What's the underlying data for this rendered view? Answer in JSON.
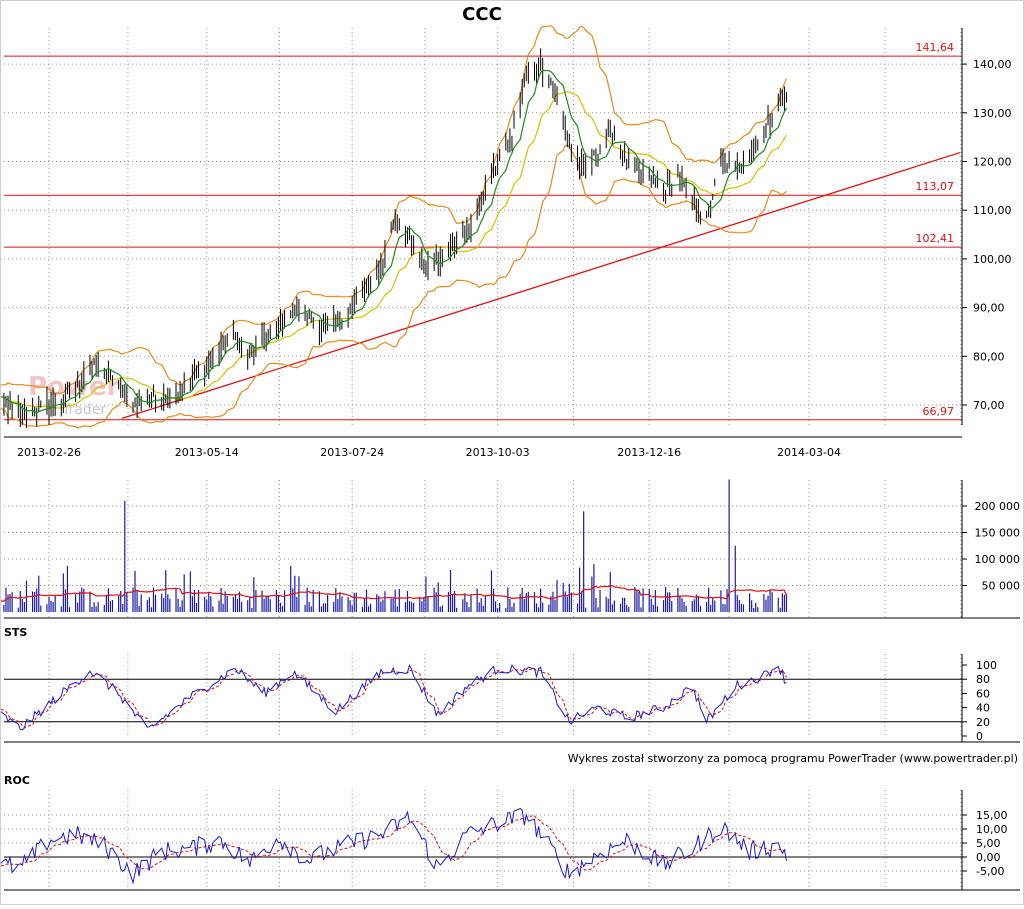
{
  "chart_data": [
    {
      "type": "line",
      "title": "CCC",
      "panel": "price",
      "subtype": "ohlc-bars with moving averages and bollinger bands",
      "x_labels": [
        "2013-02-26",
        "2013-05-14",
        "2013-07-24",
        "2013-10-03",
        "2013-12-16",
        "2014-03-04"
      ],
      "y_ticks": [
        70,
        80,
        90,
        100,
        110,
        120,
        130,
        140
      ],
      "y_tick_labels": [
        "70,00",
        "80,00",
        "90,00",
        "100,00",
        "110,00",
        "120,00",
        "130,00",
        "140,00"
      ],
      "ylim": [
        65,
        145
      ],
      "ylabel": "",
      "xlabel": "",
      "grid": true,
      "levels": [
        {
          "label": "141,64",
          "value": 141.64
        },
        {
          "label": "113,07",
          "value": 113.07
        },
        {
          "label": "102,41",
          "value": 102.41
        },
        {
          "label": "66,97",
          "value": 66.97
        }
      ],
      "trendline": {
        "from": {
          "x": "2013-02-26",
          "y": 62.5
        },
        "to": {
          "x": "2014-03-04",
          "y": 112.0
        }
      },
      "close_anchor_points": [
        [
          "2013-01-29",
          72
        ],
        [
          "2013-02-04",
          70
        ],
        [
          "2013-02-12",
          68
        ],
        [
          "2013-02-26",
          70
        ],
        [
          "2013-03-05",
          71
        ],
        [
          "2013-03-11",
          74
        ],
        [
          "2013-03-18",
          78
        ],
        [
          "2013-03-25",
          77
        ],
        [
          "2013-04-01",
          74
        ],
        [
          "2013-04-08",
          70
        ],
        [
          "2013-04-15",
          71
        ],
        [
          "2013-04-22",
          72
        ],
        [
          "2013-04-29",
          72
        ],
        [
          "2013-05-06",
          75
        ],
        [
          "2013-05-14",
          78
        ],
        [
          "2013-05-21",
          82
        ],
        [
          "2013-05-28",
          84
        ],
        [
          "2013-06-04",
          80
        ],
        [
          "2013-06-11",
          84
        ],
        [
          "2013-06-18",
          86
        ],
        [
          "2013-06-25",
          90
        ],
        [
          "2013-07-02",
          89
        ],
        [
          "2013-07-09",
          85
        ],
        [
          "2013-07-16",
          87
        ],
        [
          "2013-07-24",
          90
        ],
        [
          "2013-07-31",
          94
        ],
        [
          "2013-08-07",
          98
        ],
        [
          "2013-08-14",
          109
        ],
        [
          "2013-08-21",
          104
        ],
        [
          "2013-08-28",
          98
        ],
        [
          "2013-09-04",
          100
        ],
        [
          "2013-09-11",
          104
        ],
        [
          "2013-09-18",
          105
        ],
        [
          "2013-09-25",
          112
        ],
        [
          "2013-10-03",
          120
        ],
        [
          "2013-10-10",
          125
        ],
        [
          "2013-10-17",
          138
        ],
        [
          "2013-10-24",
          140
        ],
        [
          "2013-10-31",
          135
        ],
        [
          "2013-11-07",
          124
        ],
        [
          "2013-11-14",
          118
        ],
        [
          "2013-11-21",
          122
        ],
        [
          "2013-11-28",
          126
        ],
        [
          "2013-12-05",
          120
        ],
        [
          "2013-12-16",
          116
        ],
        [
          "2013-12-23",
          114
        ],
        [
          "2013-12-30",
          117
        ],
        [
          "2014-01-06",
          112
        ],
        [
          "2014-01-13",
          108
        ],
        [
          "2014-01-20",
          120
        ],
        [
          "2014-01-27",
          118
        ],
        [
          "2014-02-03",
          122
        ],
        [
          "2014-02-10",
          126
        ],
        [
          "2014-02-17",
          132
        ],
        [
          "2014-02-21",
          133
        ]
      ]
    },
    {
      "type": "bar",
      "panel": "volume",
      "y_ticks": [
        50000,
        100000,
        150000,
        200000
      ],
      "y_tick_labels": [
        "50 000",
        "100 000",
        "150 000",
        "200 000"
      ],
      "ylim": [
        0,
        250000
      ],
      "spikes": [
        {
          "x": "2013-04-04",
          "value": 210000
        },
        {
          "x": "2013-11-14",
          "value": 190000
        },
        {
          "x": "2014-01-24",
          "value": 250000
        },
        {
          "x": "2014-01-27",
          "value": 125000
        }
      ],
      "baseline_level": 25000
    },
    {
      "type": "line",
      "title": "STS",
      "panel": "stochastic",
      "y_ticks": [
        0,
        20,
        40,
        60,
        80,
        100
      ],
      "y_tick_labels": [
        "0",
        "20",
        "40",
        "60",
        "80",
        "100"
      ],
      "ylim": [
        0,
        100
      ],
      "levels": [
        20,
        80
      ],
      "anchor_points": [
        [
          "2013-01-29",
          40
        ],
        [
          "2013-02-12",
          10
        ],
        [
          "2013-02-26",
          45
        ],
        [
          "2013-03-18",
          92
        ],
        [
          "2013-04-01",
          60
        ],
        [
          "2013-04-15",
          8
        ],
        [
          "2013-05-06",
          55
        ],
        [
          "2013-05-28",
          95
        ],
        [
          "2013-06-11",
          60
        ],
        [
          "2013-06-25",
          90
        ],
        [
          "2013-07-16",
          35
        ],
        [
          "2013-08-07",
          90
        ],
        [
          "2013-08-21",
          95
        ],
        [
          "2013-09-04",
          30
        ],
        [
          "2013-09-18",
          70
        ],
        [
          "2013-10-03",
          95
        ],
        [
          "2013-10-24",
          90
        ],
        [
          "2013-11-07",
          20
        ],
        [
          "2013-11-21",
          40
        ],
        [
          "2013-12-05",
          25
        ],
        [
          "2013-12-23",
          40
        ],
        [
          "2014-01-06",
          70
        ],
        [
          "2014-01-13",
          20
        ],
        [
          "2014-01-27",
          70
        ],
        [
          "2014-02-10",
          85
        ],
        [
          "2014-02-17",
          100
        ],
        [
          "2014-02-21",
          75
        ]
      ]
    },
    {
      "type": "line",
      "title": "ROC",
      "panel": "rate-of-change",
      "y_ticks": [
        -5,
        0,
        5,
        10,
        15
      ],
      "y_tick_labels": [
        "-5,00",
        "0,00",
        "5,00",
        "10,00",
        "15,00"
      ],
      "ylim": [
        -8,
        17
      ],
      "levels": [
        0
      ],
      "anchor_points": [
        [
          "2013-01-29",
          -2
        ],
        [
          "2013-02-12",
          -4
        ],
        [
          "2013-02-26",
          6
        ],
        [
          "2013-03-11",
          8
        ],
        [
          "2013-03-25",
          4
        ],
        [
          "2013-04-08",
          -6
        ],
        [
          "2013-04-22",
          2
        ],
        [
          "2013-05-06",
          3
        ],
        [
          "2013-05-21",
          6
        ],
        [
          "2013-06-04",
          -2
        ],
        [
          "2013-06-18",
          7
        ],
        [
          "2013-07-02",
          -1
        ],
        [
          "2013-07-24",
          5
        ],
        [
          "2013-08-07",
          8
        ],
        [
          "2013-08-21",
          14
        ],
        [
          "2013-09-04",
          -4
        ],
        [
          "2013-09-18",
          8
        ],
        [
          "2013-10-03",
          12
        ],
        [
          "2013-10-17",
          15
        ],
        [
          "2013-11-07",
          -6
        ],
        [
          "2013-11-21",
          1
        ],
        [
          "2013-12-05",
          6
        ],
        [
          "2013-12-23",
          -3
        ],
        [
          "2014-01-06",
          3
        ],
        [
          "2014-01-20",
          11
        ],
        [
          "2014-02-03",
          2
        ],
        [
          "2014-02-17",
          4
        ],
        [
          "2014-02-21",
          1
        ]
      ]
    }
  ],
  "footer": {
    "credit": "Wykres został stworzony za pomocą programu PowerTrader (www.powertrader.pl)"
  },
  "watermark": {
    "text": "PowerTrader"
  },
  "colors": {
    "bars": "#000000",
    "ma_short": "#1a8f1a",
    "ma_long": "#d8c000",
    "bands": "#e68a1a",
    "lines_red": "#dd1111",
    "volume": "#1a1aa6",
    "indicator_blue": "#1a1ad0",
    "indicator_red": "#dd1111",
    "grid": "#9a9a9a"
  }
}
